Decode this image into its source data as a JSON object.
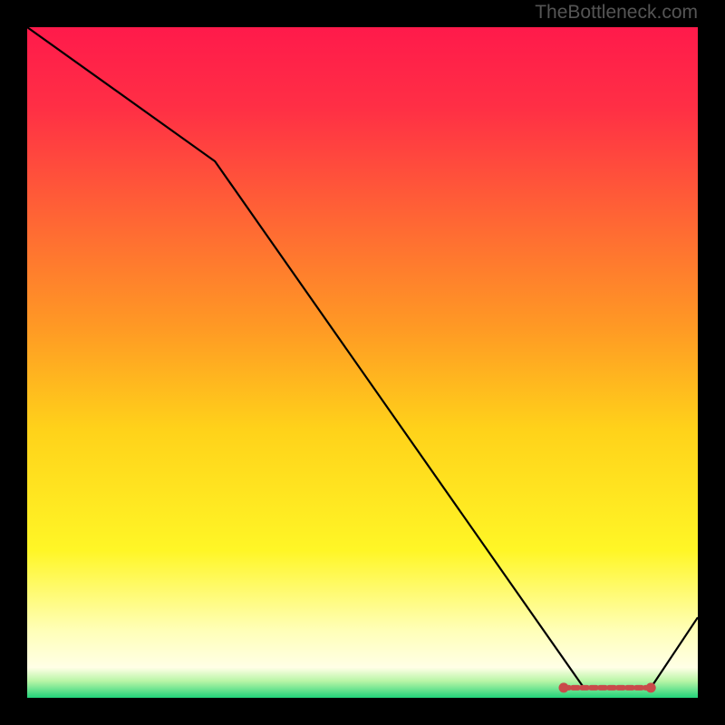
{
  "attribution": "TheBottleneck.com",
  "chart_data": {
    "type": "line",
    "title": "",
    "xlabel": "",
    "ylabel": "",
    "xlim": [
      0,
      100
    ],
    "ylim": [
      0,
      100
    ],
    "x": [
      0,
      28,
      83,
      93,
      100
    ],
    "y": [
      100,
      80,
      1.5,
      1.5,
      12
    ],
    "marker_region": {
      "x_start": 80,
      "x_end": 93,
      "y": 1.5
    },
    "background_gradient": {
      "stops": [
        {
          "offset": 0.0,
          "color": "#ff1a4b"
        },
        {
          "offset": 0.12,
          "color": "#ff2f45"
        },
        {
          "offset": 0.3,
          "color": "#ff6a33"
        },
        {
          "offset": 0.45,
          "color": "#ff9a24"
        },
        {
          "offset": 0.6,
          "color": "#ffd21a"
        },
        {
          "offset": 0.78,
          "color": "#fff626"
        },
        {
          "offset": 0.9,
          "color": "#ffffb8"
        },
        {
          "offset": 0.955,
          "color": "#ffffe6"
        },
        {
          "offset": 0.975,
          "color": "#b8f5a6"
        },
        {
          "offset": 1.0,
          "color": "#22d37a"
        }
      ]
    },
    "line_color": "#000000",
    "marker_color": "#c94a4a"
  }
}
